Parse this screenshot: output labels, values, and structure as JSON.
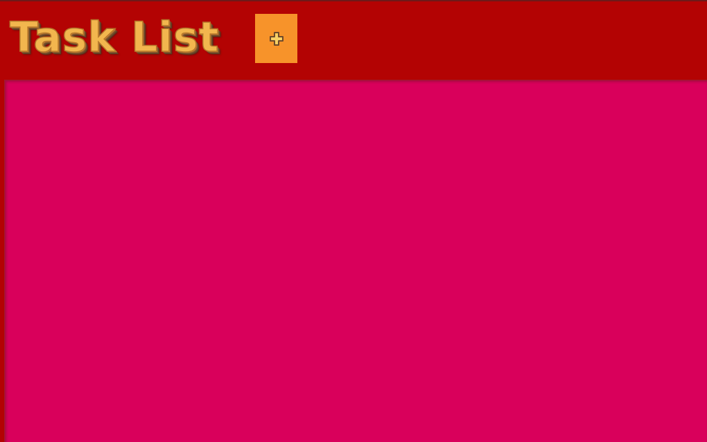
{
  "header": {
    "title": "Task List",
    "add_button": {
      "label": "+",
      "icon": "plus-icon"
    }
  },
  "task_list": {
    "items": []
  },
  "colors": {
    "header_background": "#b30303",
    "list_background": "#d9005b",
    "add_button_background": "#f7932a",
    "title_color": "#f2b64e"
  }
}
